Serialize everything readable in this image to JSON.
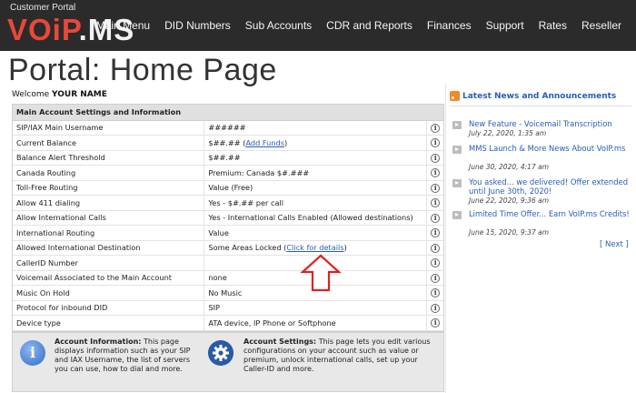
{
  "header": {
    "brand_sub": "Customer Portal",
    "brand_part1": "VOiP",
    "brand_part2": ".MS",
    "nav": [
      "Main Menu",
      "DID Numbers",
      "Sub Accounts",
      "CDR and Reports",
      "Finances",
      "Support",
      "Rates",
      "Reseller"
    ]
  },
  "page_title": "Portal: Home Page",
  "welcome": {
    "prefix": "Welcome",
    "name": "YOUR NAME"
  },
  "settings": {
    "heading": "Main Account Settings and Information",
    "rows": [
      {
        "label": "SIP/IAX Main Username",
        "value": "######"
      },
      {
        "label": "Current Balance",
        "value": "$##.##",
        "link": "Add Funds"
      },
      {
        "label": "Balance Alert Threshold",
        "value": "$##.##"
      },
      {
        "label": "Canada Routing",
        "value": "Premium: Canada $#.###"
      },
      {
        "label": "Toll-Free Routing",
        "value": "Value (Free)"
      },
      {
        "label": "Allow 411 dialing",
        "value": "Yes - $#.## per call"
      },
      {
        "label": "Allow International Calls",
        "value": "Yes - International Calls Enabled (Allowed destinations)"
      },
      {
        "label": "International Routing",
        "value": "Value"
      },
      {
        "label": "Allowed International Destination",
        "value": "Some Areas Locked",
        "link": "Click for details"
      },
      {
        "label": "CallerID Number",
        "value": ""
      },
      {
        "label": "Voicemail Associated to the Main Account",
        "value": "none"
      },
      {
        "label": "Music On Hold",
        "value": "No Music"
      },
      {
        "label": "Protocol for inbound DID",
        "value": "SIP"
      },
      {
        "label": "Device type",
        "value": "ATA device, IP Phone or Softphone"
      }
    ]
  },
  "panels": {
    "account_title": "Account Information:",
    "account_text": "This page displays information such as your SIP and IAX Username, the list of servers you can use, how to dial and more.",
    "settings_title": "Account Settings:",
    "settings_text": "This page lets you edit various configurations on your account such as value or premium, unlock international calls, set up your Caller-ID and more."
  },
  "news": {
    "heading": "Latest News and Announcements",
    "items": [
      {
        "title": "New Feature - Voicemail Transcription",
        "date": "July 22, 2020, 1:35 am"
      },
      {
        "title": "MMS Launch & More News About VoIP.ms",
        "date": "June 30, 2020, 4:17 am"
      },
      {
        "title": "You asked... we delivered! Offer extended until June 30th, 2020!",
        "date": "June 22, 2020, 9:36 am"
      },
      {
        "title": "Limited Time Offer... Earn VoIP.ms Credits!",
        "date": "June 15, 2020, 9:37 am"
      }
    ],
    "next": "[ Next ]"
  },
  "colors": {
    "topbar": "#2b2b2b",
    "brand_red": "#e8483a",
    "link_blue": "#2a5bb8",
    "annotation_red": "#e02020"
  }
}
